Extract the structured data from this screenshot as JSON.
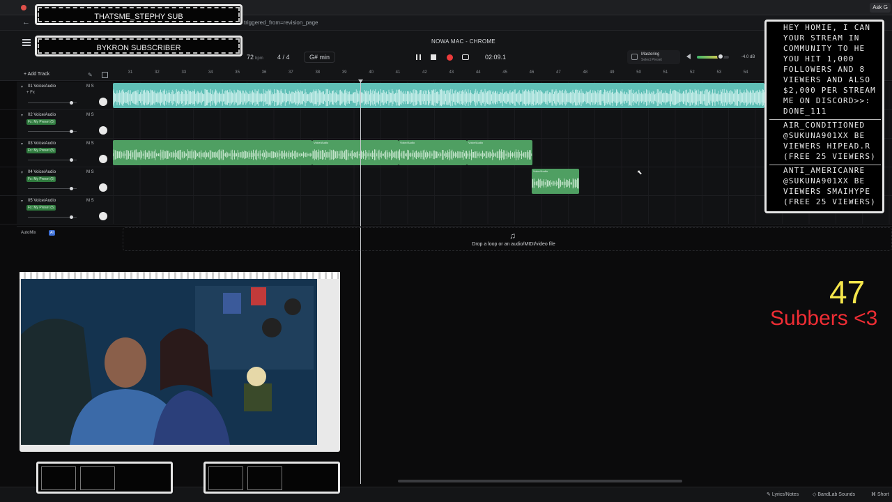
{
  "browser": {
    "url_fragment": "triggered_from=revision_page",
    "ask_button": "Ask G"
  },
  "daw": {
    "window_title": "NOWA MAC - CHROME",
    "bpm": "72",
    "bpm_unit": "bpm",
    "time_signature": "4 / 4",
    "key": "G# min",
    "time": "02:09.1",
    "master_title": "Mastering",
    "master_sub": "Select Preset",
    "db": "-4.0 dB",
    "add_track": "Add Track",
    "automix": "AutoMix",
    "ai_badge": "AI",
    "drop_text": "Drop a loop or an audio/MIDI/video file",
    "bar_numbers": [
      "31",
      "32",
      "33",
      "34",
      "35",
      "36",
      "37",
      "38",
      "39",
      "40",
      "41",
      "42",
      "43",
      "44",
      "45",
      "46",
      "47",
      "48",
      "49",
      "50",
      "51",
      "52",
      "53",
      "54"
    ]
  },
  "tracks": [
    {
      "name": "01 Voice/Audio",
      "chip": "+ Fx",
      "chip_type": "fx",
      "ms": "M  S",
      "fader": 0.88
    },
    {
      "name": "02 Voice/Audio",
      "chip": "Fx: My Preset (5)",
      "chip_type": "preset",
      "ms": "M  S",
      "fader": 0.88
    },
    {
      "name": "03 Voice/Audio",
      "chip": "Fx: My Preset (5)",
      "chip_type": "preset",
      "ms": "M  S",
      "fader": 0.88
    },
    {
      "name": "04 Voice/Audio",
      "chip": "Fx: My Preset (5)",
      "chip_type": "preset",
      "ms": "M  S",
      "fader": 0.88
    },
    {
      "name": "05 Voice/Audio",
      "chip": "Fx: My Preset (5)",
      "chip_type": "preset",
      "ms": "M  S",
      "fader": 0.88
    }
  ],
  "clips": {
    "track3_labels": [
      "Voice/Audio",
      "Voice/Audio",
      "Voice/Audio"
    ],
    "track4_label": "Voice/Audio"
  },
  "bottom_bar": {
    "lyrics": "Lyrics/Notes",
    "sounds": "BandLab Sounds",
    "shortcuts": "Short"
  },
  "overlay": {
    "sub_top": "THATSME_STEPHY SUB",
    "sub_bottom": "BYKRON SUBSCRIBER",
    "chat": [
      "HEY HOMIE, I CAN",
      "YOUR STREAM IN",
      "COMMUNITY TO HE",
      "YOU HIT 1,000",
      "FOLLOWERS AND 8",
      "VIEWERS AND ALSO",
      "$2,000 PER STREAM",
      "ME ON DISCORD>>:",
      "DONE_111",
      "AIR_CONDITIONED",
      "@SUKUNA901XX BE",
      "VIEWERS HIPEAD.R",
      "(FREE 25 VIEWERS)",
      "ANTI_AMERICANRE",
      "@SUKUNA901XX BE",
      "VIEWERS SMAIHYPE",
      "(FREE 25 VIEWERS)"
    ],
    "counter_number": "47",
    "counter_label": "Subbers <3"
  },
  "colors": {
    "cyan_clip": "#5fbfb6",
    "green_clip": "#4f9f62",
    "record": "#ec3b3b",
    "counter_number": "#f5e64b",
    "counter_label": "#ef2d34"
  }
}
